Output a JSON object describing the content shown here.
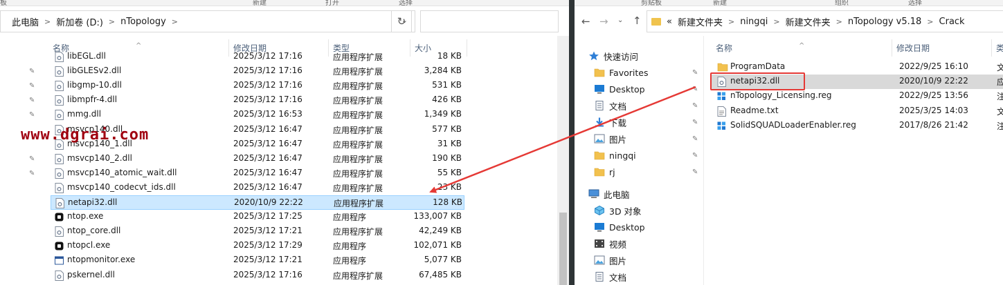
{
  "left_window": {
    "ribbon": [
      "板",
      "新建",
      "打开",
      "选择"
    ],
    "breadcrumb": [
      "此电脑",
      "新加卷 (D:)",
      "nTopology"
    ],
    "columns": {
      "name": "名称",
      "date": "修改日期",
      "type": "类型",
      "size": "大小"
    },
    "files": [
      {
        "name": "libEGL.dll",
        "date": "2025/3/12 17:16",
        "type": "应用程序扩展",
        "size": "18 KB",
        "icon": "dll-file-icon",
        "pinned": false
      },
      {
        "name": "libGLESv2.dll",
        "date": "2025/3/12 17:16",
        "type": "应用程序扩展",
        "size": "3,284 KB",
        "icon": "dll-file-icon",
        "pinned": true
      },
      {
        "name": "libgmp-10.dll",
        "date": "2025/3/12 17:16",
        "type": "应用程序扩展",
        "size": "531 KB",
        "icon": "dll-file-icon",
        "pinned": true
      },
      {
        "name": "libmpfr-4.dll",
        "date": "2025/3/12 17:16",
        "type": "应用程序扩展",
        "size": "426 KB",
        "icon": "dll-file-icon",
        "pinned": true
      },
      {
        "name": "mmg.dll",
        "date": "2025/3/12 16:53",
        "type": "应用程序扩展",
        "size": "1,349 KB",
        "icon": "dll-file-icon",
        "pinned": true
      },
      {
        "name": "msvcp140.dll",
        "date": "2025/3/12 16:47",
        "type": "应用程序扩展",
        "size": "577 KB",
        "icon": "dll-file-icon",
        "pinned": false
      },
      {
        "name": "msvcp140_1.dll",
        "date": "2025/3/12 16:47",
        "type": "应用程序扩展",
        "size": "31 KB",
        "icon": "dll-file-icon",
        "pinned": false
      },
      {
        "name": "msvcp140_2.dll",
        "date": "2025/3/12 16:47",
        "type": "应用程序扩展",
        "size": "190 KB",
        "icon": "dll-file-icon",
        "pinned": true
      },
      {
        "name": "msvcp140_atomic_wait.dll",
        "date": "2025/3/12 16:47",
        "type": "应用程序扩展",
        "size": "55 KB",
        "icon": "dll-file-icon",
        "pinned": true
      },
      {
        "name": "msvcp140_codecvt_ids.dll",
        "date": "2025/3/12 16:47",
        "type": "应用程序扩展",
        "size": "23 KB",
        "icon": "dll-file-icon",
        "pinned": false
      },
      {
        "name": "netapi32.dll",
        "date": "2020/10/9 22:22",
        "type": "应用程序扩展",
        "size": "128 KB",
        "icon": "dll-file-icon",
        "pinned": false,
        "selected": true
      },
      {
        "name": "ntop.exe",
        "date": "2025/3/12 17:25",
        "type": "应用程序",
        "size": "133,007 KB",
        "icon": "ntop-app-icon",
        "pinned": false
      },
      {
        "name": "ntop_core.dll",
        "date": "2025/3/12 17:21",
        "type": "应用程序扩展",
        "size": "42,249 KB",
        "icon": "dll-file-icon",
        "pinned": false
      },
      {
        "name": "ntopcl.exe",
        "date": "2025/3/12 17:29",
        "type": "应用程序",
        "size": "102,071 KB",
        "icon": "ntop-app-icon",
        "pinned": false
      },
      {
        "name": "ntopmonitor.exe",
        "date": "2025/3/12 17:21",
        "type": "应用程序",
        "size": "5,077 KB",
        "icon": "exe-window-icon",
        "pinned": false
      },
      {
        "name": "pskernel.dll",
        "date": "2025/3/12 17:16",
        "type": "应用程序扩展",
        "size": "67,485 KB",
        "icon": "dll-file-icon",
        "pinned": false
      }
    ],
    "watermark": "www.dgrai.com"
  },
  "right_window": {
    "ribbon": [
      "剪贴板",
      "新建",
      "组织",
      "选择"
    ],
    "breadcrumb_prefix": "«",
    "breadcrumb": [
      "新建文件夹",
      "ningqi",
      "新建文件夹",
      "nTopology v5.18",
      "Crack"
    ],
    "columns": {
      "name": "名称",
      "date": "修改日期",
      "type": "类"
    },
    "nav": [
      {
        "label": "快速访问",
        "icon": "star-icon",
        "indent": 0,
        "pinned": false
      },
      {
        "label": "Favorites",
        "icon": "folder-icon",
        "indent": 1,
        "pinned": true
      },
      {
        "label": "Desktop",
        "icon": "desktop-icon",
        "indent": 1,
        "pinned": true
      },
      {
        "label": "文档",
        "icon": "document-icon",
        "indent": 1,
        "pinned": true
      },
      {
        "label": "下载",
        "icon": "download-icon",
        "indent": 1,
        "pinned": true
      },
      {
        "label": "图片",
        "icon": "pictures-icon",
        "indent": 1,
        "pinned": true
      },
      {
        "label": "ningqi",
        "icon": "folder-icon",
        "indent": 1,
        "pinned": true
      },
      {
        "label": "rj",
        "icon": "folder-icon",
        "indent": 1,
        "pinned": true
      },
      {
        "label": "此电脑",
        "icon": "computer-icon",
        "indent": 0,
        "pinned": false
      },
      {
        "label": "3D 对象",
        "icon": "cube-3d-icon",
        "indent": 1,
        "pinned": false
      },
      {
        "label": "Desktop",
        "icon": "desktop-icon",
        "indent": 1,
        "pinned": false
      },
      {
        "label": "视频",
        "icon": "video-icon",
        "indent": 1,
        "pinned": false
      },
      {
        "label": "图片",
        "icon": "pictures-icon",
        "indent": 1,
        "pinned": false
      },
      {
        "label": "文档",
        "icon": "document-icon",
        "indent": 1,
        "pinned": false
      }
    ],
    "files": [
      {
        "name": "ProgramData",
        "date": "2022/9/25 16:10",
        "type": "文",
        "icon": "folder-icon"
      },
      {
        "name": "netapi32.dll",
        "date": "2020/10/9 22:22",
        "type": "应",
        "icon": "dll-file-icon",
        "selected": true
      },
      {
        "name": "nTopology_Licensing.reg",
        "date": "2022/9/25 13:56",
        "type": "注",
        "icon": "reg-file-icon"
      },
      {
        "name": "Readme.txt",
        "date": "2025/3/25 14:03",
        "type": "文",
        "icon": "text-file-icon"
      },
      {
        "name": "SolidSQUADLoaderEnabler.reg",
        "date": "2017/8/26 21:42",
        "type": "注",
        "icon": "reg-file-icon"
      }
    ]
  },
  "colors": {
    "selection_bg": "#cce8ff",
    "selection_border": "#99d1ff",
    "right_selected_bg": "#d9d9d9",
    "annotation_red": "#e53935",
    "watermark": "#a00010",
    "divider": "#2e3436",
    "header_text": "#4c607a"
  }
}
